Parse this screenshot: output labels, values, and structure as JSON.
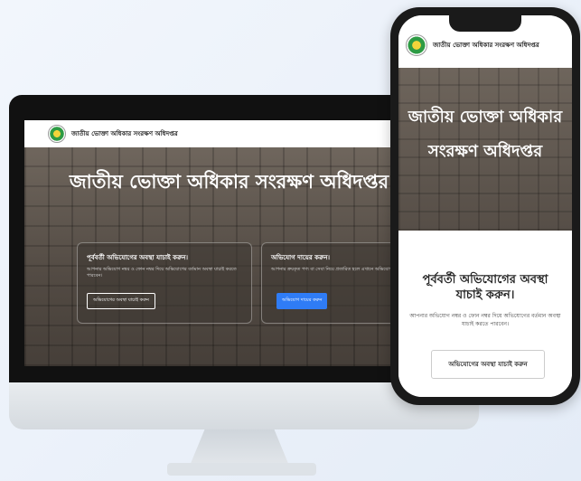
{
  "site": {
    "title": "জাতীয় ভোক্তা অধিকার সংরক্ষণ অধিদপ্তর"
  },
  "desktop": {
    "hero_title": "জাতীয় ভোক্তা অধিকার সংরক্ষণ অধিদপ্তর",
    "card1": {
      "title": "পূর্ববর্তী অভিযোগের অবস্থা যাচাই করুন।",
      "text": "আপনার অভিযোগ নম্বর ও ফোন নম্বর দিয়ে অভিযোগের বর্তমান অবস্থা যাচাই করতে পারবেন।",
      "button": "অভিযোগের অবস্থা যাচাই করুন"
    },
    "card2": {
      "title": "অভিযোগ দায়ের করুন।",
      "text": "আপনার ক্রয়কৃত পণ্য বা সেবা নিয়ে প্রতারিত হলে এখানে অভিযোগ দায়ের করুন।",
      "button": "অভিযোগ দায়ের করুন"
    }
  },
  "mobile": {
    "hero_title": "জাতীয় ভোক্তা অধিকার সংরক্ষণ অধিদপ্তর",
    "section_title": "পূর্ববর্তী অভিযোগের অবস্থা যাচাই করুন।",
    "section_text": "আপনার অভিযোগ নম্বর ও ফোন নম্বর দিয়ে অভিযোগের বর্তমান অবস্থা যাচাই করতে পারবেন।",
    "button": "অভিযোগের অবস্থা যাচাই করুন"
  },
  "colors": {
    "accent": "#2f7cf6",
    "logo_green": "#2e9b44",
    "logo_yellow": "#f3d43a"
  }
}
